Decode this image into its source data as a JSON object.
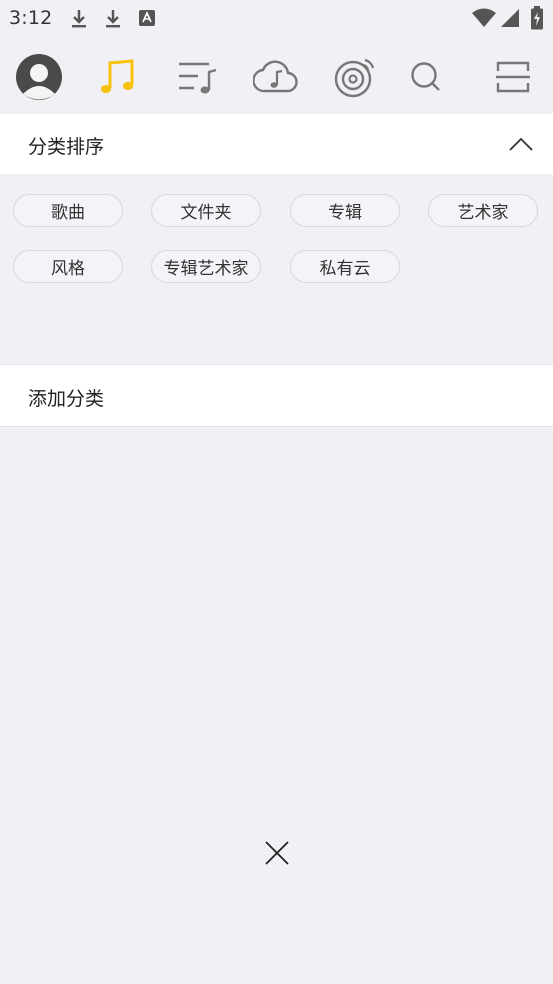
{
  "status_bar": {
    "time": "3:12",
    "left_icons": [
      "download-icon",
      "download-icon",
      "font-icon"
    ],
    "right_icons": [
      "wifi-icon",
      "signal-icon",
      "battery-icon"
    ]
  },
  "nav": {
    "items": [
      {
        "name": "avatar"
      },
      {
        "name": "music-note-icon",
        "active": true
      },
      {
        "name": "playlist-icon"
      },
      {
        "name": "cloud-music-icon"
      },
      {
        "name": "radio-icon"
      },
      {
        "name": "search-icon"
      },
      {
        "name": "scan-icon"
      }
    ],
    "accent_color": "#f7c20a"
  },
  "category_sort": {
    "title": "分类排序",
    "toggle_icon": "chevron-up-icon",
    "chips": [
      "歌曲",
      "文件夹",
      "专辑",
      "艺术家",
      "风格",
      "专辑艺术家",
      "私有云"
    ]
  },
  "add_category": {
    "label": "添加分类"
  },
  "close": {
    "icon": "close-icon"
  }
}
